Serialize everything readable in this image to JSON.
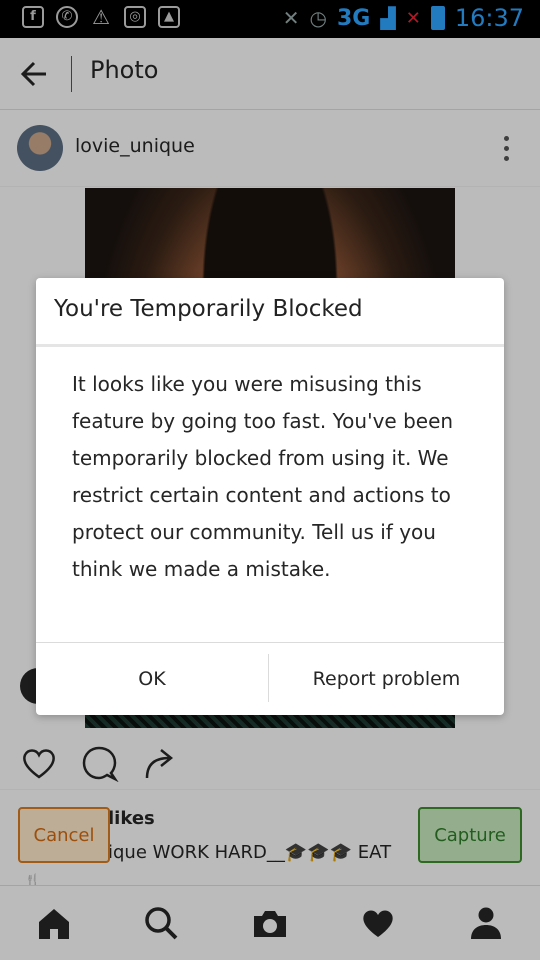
{
  "status_bar": {
    "network": "3G",
    "time": "16:37"
  },
  "header": {
    "title": "Photo"
  },
  "post": {
    "username": "lovie_unique",
    "likes_text": "likes",
    "caption": "ique WORK HARD__🎓🎓🎓 EAT"
  },
  "overlay_buttons": {
    "cancel": "Cancel",
    "capture": "Capture"
  },
  "dialog": {
    "title": "You're Temporarily Blocked",
    "body": "It looks like you were misusing this feature by going too fast. You've been temporarily blocked from using it. We restrict certain content and actions to protect our community. Tell us if you think we made a mistake.",
    "ok": "OK",
    "report": "Report problem"
  }
}
